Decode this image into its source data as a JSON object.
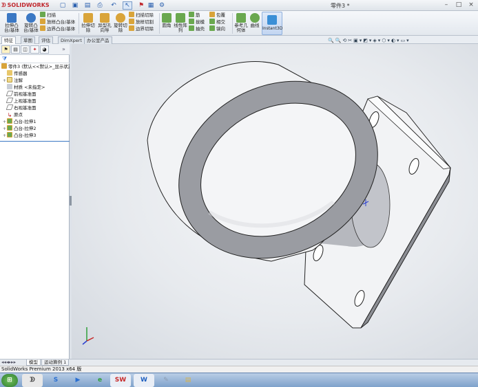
{
  "app": {
    "logo_text": "SOLIDWORKS",
    "window_title": "零件3 *",
    "status_text": "SolidWorks Premium 2013 x64 版"
  },
  "quick_access": [
    "new-icon",
    "open-icon",
    "save-icon",
    "print-icon",
    "undo-icon",
    "select-icon",
    "rebuild-icon",
    "file-properties-icon",
    "options-icon"
  ],
  "ribbon": {
    "big_buttons": [
      {
        "label": "拉伸凸台/基体",
        "icon": "extruded-boss-icon",
        "color": "#3b78c4"
      },
      {
        "label": "旋转凸台/基体",
        "icon": "revolved-boss-icon",
        "color": "#3b78c4"
      },
      {
        "label": "拉伸切除",
        "icon": "extruded-cut-icon",
        "color": "#d9a43a"
      },
      {
        "label": "异型孔向导",
        "icon": "hole-wizard-icon",
        "color": "#d9a43a"
      },
      {
        "label": "旋转切除",
        "icon": "revolved-cut-icon",
        "color": "#d9a43a"
      },
      {
        "label": "圆角",
        "icon": "fillet-icon",
        "color": "#6aa84f"
      },
      {
        "label": "线性阵列",
        "icon": "linear-pattern-icon",
        "color": "#6aa84f"
      },
      {
        "label": "参考几何体",
        "icon": "reference-geometry-icon",
        "color": "#6aa84f"
      },
      {
        "label": "曲线",
        "icon": "curves-icon",
        "color": "#6aa84f"
      }
    ],
    "small_col1": [
      "扫描",
      "放样凸台/基体",
      "边界凸台/基体"
    ],
    "small_col2": [
      "扫描切除",
      "放样切割",
      "边界切除"
    ],
    "small_col3": [
      "筋",
      "拔模",
      "抽壳"
    ],
    "small_col4": [
      "包覆",
      "相交",
      "镜向"
    ],
    "instant3d_label": "Instant3D"
  },
  "command_tabs": [
    "特征",
    "草图",
    "评估",
    "DimXpert",
    "办公室产品"
  ],
  "feature_tree": {
    "root": "零件3 (默认<<默认>_显示状态",
    "items": [
      {
        "label": "传感器",
        "icon": "sensor-icon",
        "expandable": false
      },
      {
        "label": "注解",
        "icon": "annotations-icon",
        "expandable": true
      },
      {
        "label": "材质 <未指定>",
        "icon": "material-icon",
        "expandable": false
      },
      {
        "label": "前视基准面",
        "icon": "plane-icon",
        "expandable": false
      },
      {
        "label": "上视基准面",
        "icon": "plane-icon",
        "expandable": false
      },
      {
        "label": "右视基准面",
        "icon": "plane-icon",
        "expandable": false
      },
      {
        "label": "原点",
        "icon": "origin-icon",
        "expandable": false
      },
      {
        "label": "凸台-拉伸1",
        "icon": "boss-extrude-icon",
        "expandable": true
      },
      {
        "label": "凸台-拉伸2",
        "icon": "boss-extrude-icon",
        "expandable": true
      },
      {
        "label": "凸台-拉伸3",
        "icon": "boss-extrude-icon",
        "expandable": true
      }
    ]
  },
  "bottom_tabs": [
    "模型",
    "运动算例 1"
  ],
  "taskbar": [
    {
      "icon": "start-orb-icon",
      "color": "#2f7d32"
    },
    {
      "icon": "solidworks-app-icon",
      "color": "#333"
    },
    {
      "icon": "sogou-icon",
      "color": "#2a6fd1"
    },
    {
      "icon": "media-player-icon",
      "color": "#2a6fd1"
    },
    {
      "icon": "ie-browser-icon",
      "color": "#2f9e3a"
    },
    {
      "icon": "solidworks-taskbar-icon",
      "color": "#c62828"
    },
    {
      "icon": "word-icon",
      "color": "#1f5fbf"
    },
    {
      "icon": "paint-icon",
      "color": "#8a9bb0"
    },
    {
      "icon": "explorer-icon",
      "color": "#d8b24a"
    }
  ]
}
